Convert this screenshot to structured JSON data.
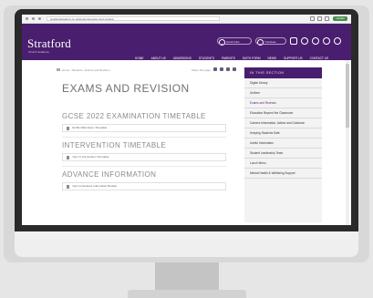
{
  "browser": {
    "url": "stratfordacademy.co.uk/students/exams-and-revision",
    "update_label": "Update"
  },
  "header": {
    "logo": "Stratford",
    "logo_sub": "Church Academy",
    "search_label": "Quick links",
    "translate_label": "Translate",
    "nav": [
      "HOME",
      "ABOUT US",
      "ADMISSIONS",
      "STUDENTS",
      "PARENTS",
      "SIXTH FORM",
      "NEWS",
      "SUPPORT US",
      "CONTACT US"
    ],
    "active_nav": "STUDENTS"
  },
  "breadcrumb": "Home › Students › Exams and Revision",
  "share_label": "Share this page",
  "page_title": "EXAMS AND REVISION",
  "sections": [
    {
      "heading": "GCSE 2022 EXAMINATION TIMETABLE",
      "file": "GCSE 2022 Exam Timetable"
    },
    {
      "heading": "INTERVENTION TIMETABLE",
      "file": "Year 11 Intervention Timetable"
    },
    {
      "heading": "ADVANCE INFORMATION",
      "file": "Year 11 Advance Information Booklet"
    }
  ],
  "sidebar": {
    "title": "IN THIS SECTION",
    "items": [
      "Digital Library",
      "Uniform",
      "Exams and Revision",
      "Education Beyond the Classroom",
      "Careers Information, Advice and Guidance",
      "Keeping Students Safe",
      "Useful Information",
      "Student Leadership Team",
      "Lunch Menu",
      "Mental Health & Wellbeing Support"
    ],
    "active_item": "Exams and Revision"
  },
  "colors": {
    "brand_purple": "#4a1e6e",
    "monitor_frame": "#d8d8d8",
    "bezel": "#2a2a2a"
  }
}
